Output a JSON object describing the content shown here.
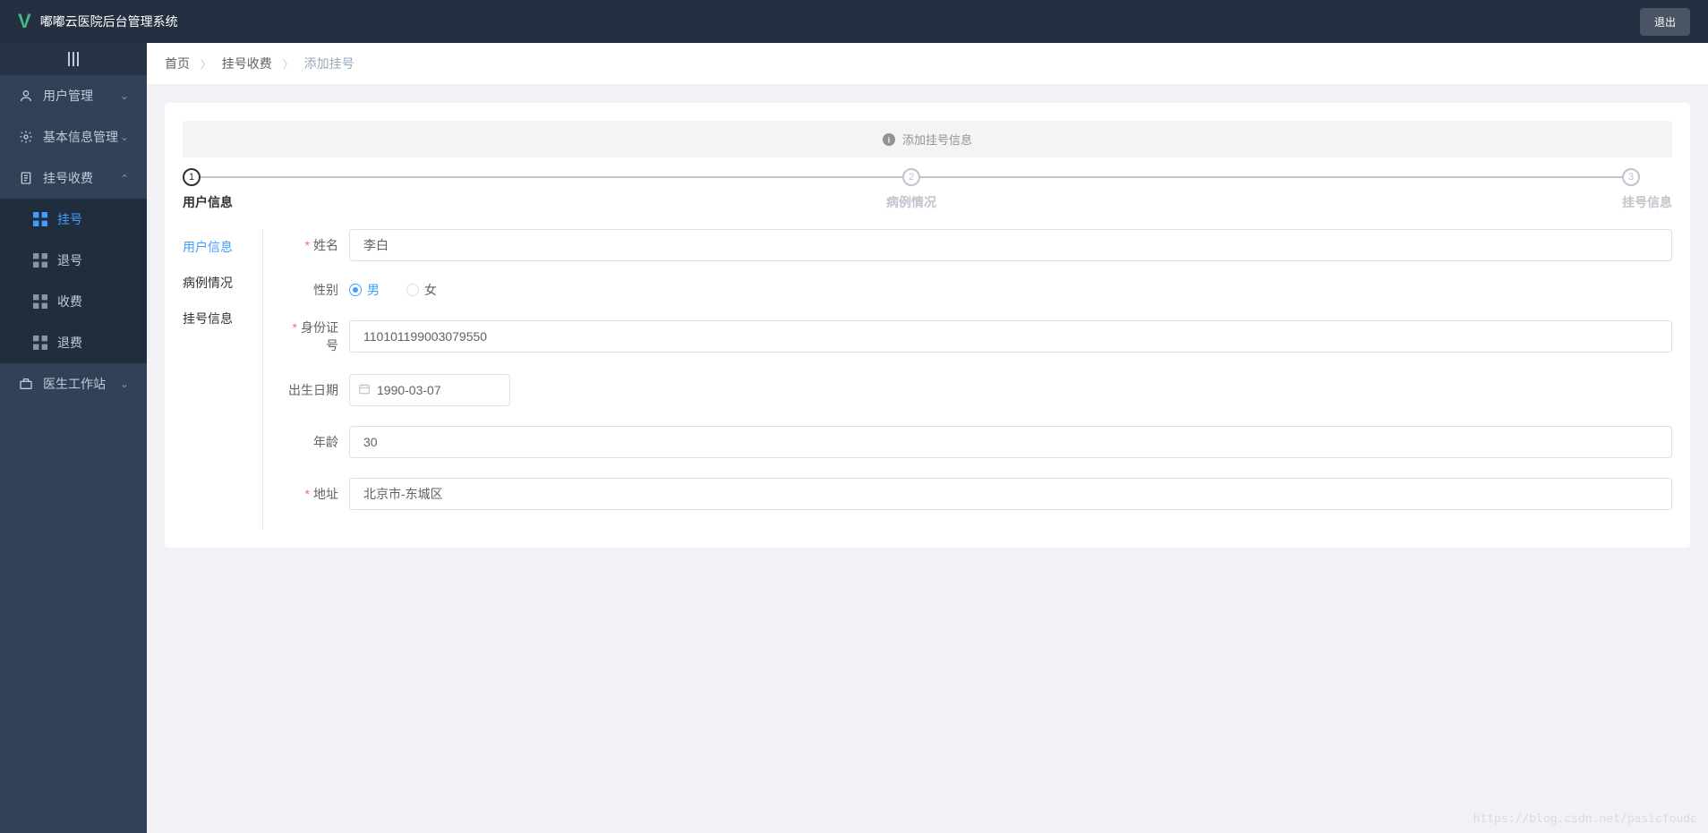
{
  "header": {
    "app_title": "嘟嘟云医院后台管理系统",
    "logout": "退出"
  },
  "sidebar": {
    "items": [
      {
        "label": "用户管理",
        "icon": "user",
        "expandable": true,
        "expanded": false
      },
      {
        "label": "基本信息管理",
        "icon": "gear",
        "expandable": true,
        "expanded": false
      },
      {
        "label": "挂号收费",
        "icon": "doc",
        "expandable": true,
        "expanded": true,
        "children": [
          {
            "label": "挂号",
            "active": true
          },
          {
            "label": "退号"
          },
          {
            "label": "收费"
          },
          {
            "label": "退费"
          }
        ]
      },
      {
        "label": "医生工作站",
        "icon": "briefcase",
        "expandable": true,
        "expanded": false
      }
    ]
  },
  "breadcrumb": {
    "items": [
      "首页",
      "挂号收费",
      "添加挂号"
    ]
  },
  "alert": {
    "text": "添加挂号信息"
  },
  "steps": [
    {
      "num": "1",
      "title": "用户信息",
      "active": true
    },
    {
      "num": "2",
      "title": "病例情况",
      "active": false
    },
    {
      "num": "3",
      "title": "挂号信息",
      "active": false
    }
  ],
  "form": {
    "tabs": [
      {
        "label": "用户信息",
        "active": true
      },
      {
        "label": "病例情况"
      },
      {
        "label": "挂号信息"
      }
    ],
    "fields": {
      "name": {
        "label": "姓名",
        "value": "李白",
        "required": true
      },
      "gender": {
        "label": "性别",
        "options": [
          "男",
          "女"
        ],
        "value": "男"
      },
      "id_number": {
        "label": "身份证号",
        "value": "110101199003079550",
        "required": true
      },
      "birth_date": {
        "label": "出生日期",
        "value": "1990-03-07"
      },
      "age": {
        "label": "年龄",
        "value": "30"
      },
      "address": {
        "label": "地址",
        "value": "北京市-东城区",
        "required": true
      }
    }
  },
  "watermark": "https://blog.csdn.net/pasicfoudc"
}
